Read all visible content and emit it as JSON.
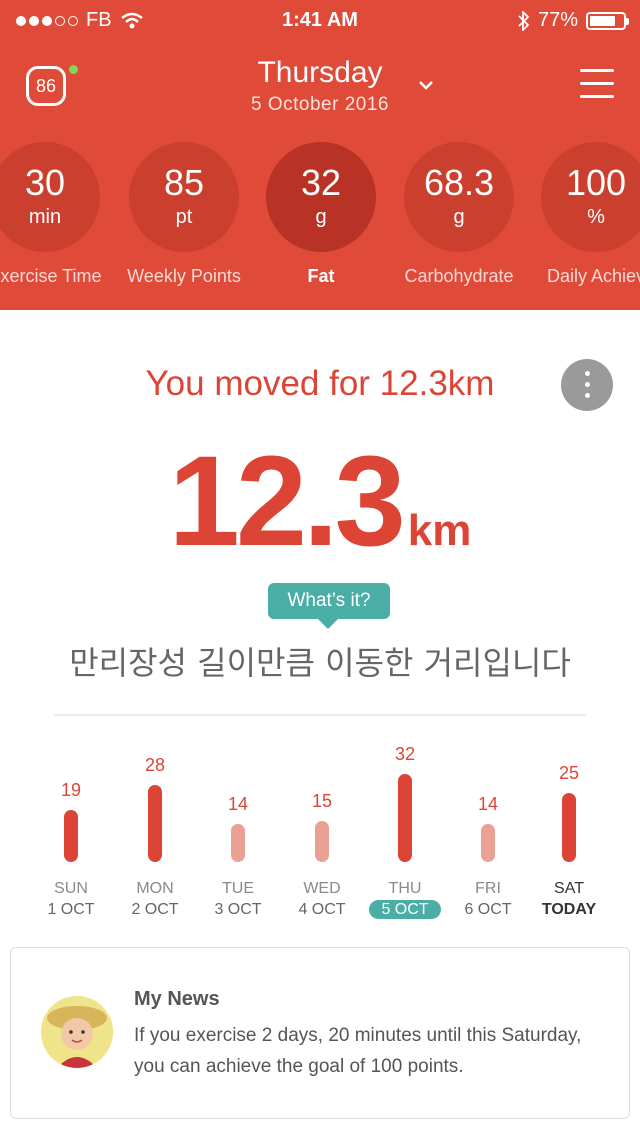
{
  "status": {
    "carrier": "FB",
    "time": "1:41 AM",
    "battery": "77%",
    "battery_level": 0.77
  },
  "header": {
    "score": "86",
    "day": "Thursday",
    "date": "5 October 2016"
  },
  "metrics": [
    {
      "value": "30",
      "unit": "min",
      "label": "Exercise Time",
      "active": false
    },
    {
      "value": "85",
      "unit": "pt",
      "label": "Weekly Points",
      "active": false
    },
    {
      "value": "32",
      "unit": "g",
      "label": "Fat",
      "active": true
    },
    {
      "value": "68.3",
      "unit": "g",
      "label": "Carbohydrate",
      "active": false
    },
    {
      "value": "100",
      "unit": "%",
      "label": "Daily Achiev",
      "active": false
    }
  ],
  "main": {
    "title": "You moved for 12.3km",
    "distance_value": "12.3",
    "distance_unit": "km",
    "whats_it": "What’s it?",
    "korean_caption": "만리장성 길이만큼 이동한 거리입니다"
  },
  "chart_data": {
    "type": "bar",
    "categories": [
      "SUN 1 OCT",
      "MON 2 OCT",
      "TUE 3 OCT",
      "WED 4 OCT",
      "THU 5 OCT",
      "FRI 6 OCT",
      "SAT TODAY"
    ],
    "values": [
      19,
      28,
      14,
      15,
      32,
      14,
      25
    ],
    "ylim": [
      0,
      32
    ]
  },
  "week": [
    {
      "day": "SUN",
      "date": "1 OCT",
      "value": "19",
      "state": "normal"
    },
    {
      "day": "MON",
      "date": "2 OCT",
      "value": "28",
      "state": "normal"
    },
    {
      "day": "TUE",
      "date": "3 OCT",
      "value": "14",
      "state": "normal"
    },
    {
      "day": "WED",
      "date": "4 OCT",
      "value": "15",
      "state": "normal"
    },
    {
      "day": "THU",
      "date": "5 OCT",
      "value": "32",
      "state": "selected"
    },
    {
      "day": "FRI",
      "date": "6 OCT",
      "value": "14",
      "state": "normal"
    },
    {
      "day": "SAT",
      "date": "TODAY",
      "value": "25",
      "state": "today"
    }
  ],
  "colors": {
    "brand": "#e04a38",
    "bar_high": "#dc4535",
    "bar_low": "#eaa092",
    "accent": "#4aaea7"
  },
  "news": {
    "title": "My News",
    "body": "If you exercise 2 days, 20 minutes until this Saturday, you can achieve the goal of 100 points."
  }
}
